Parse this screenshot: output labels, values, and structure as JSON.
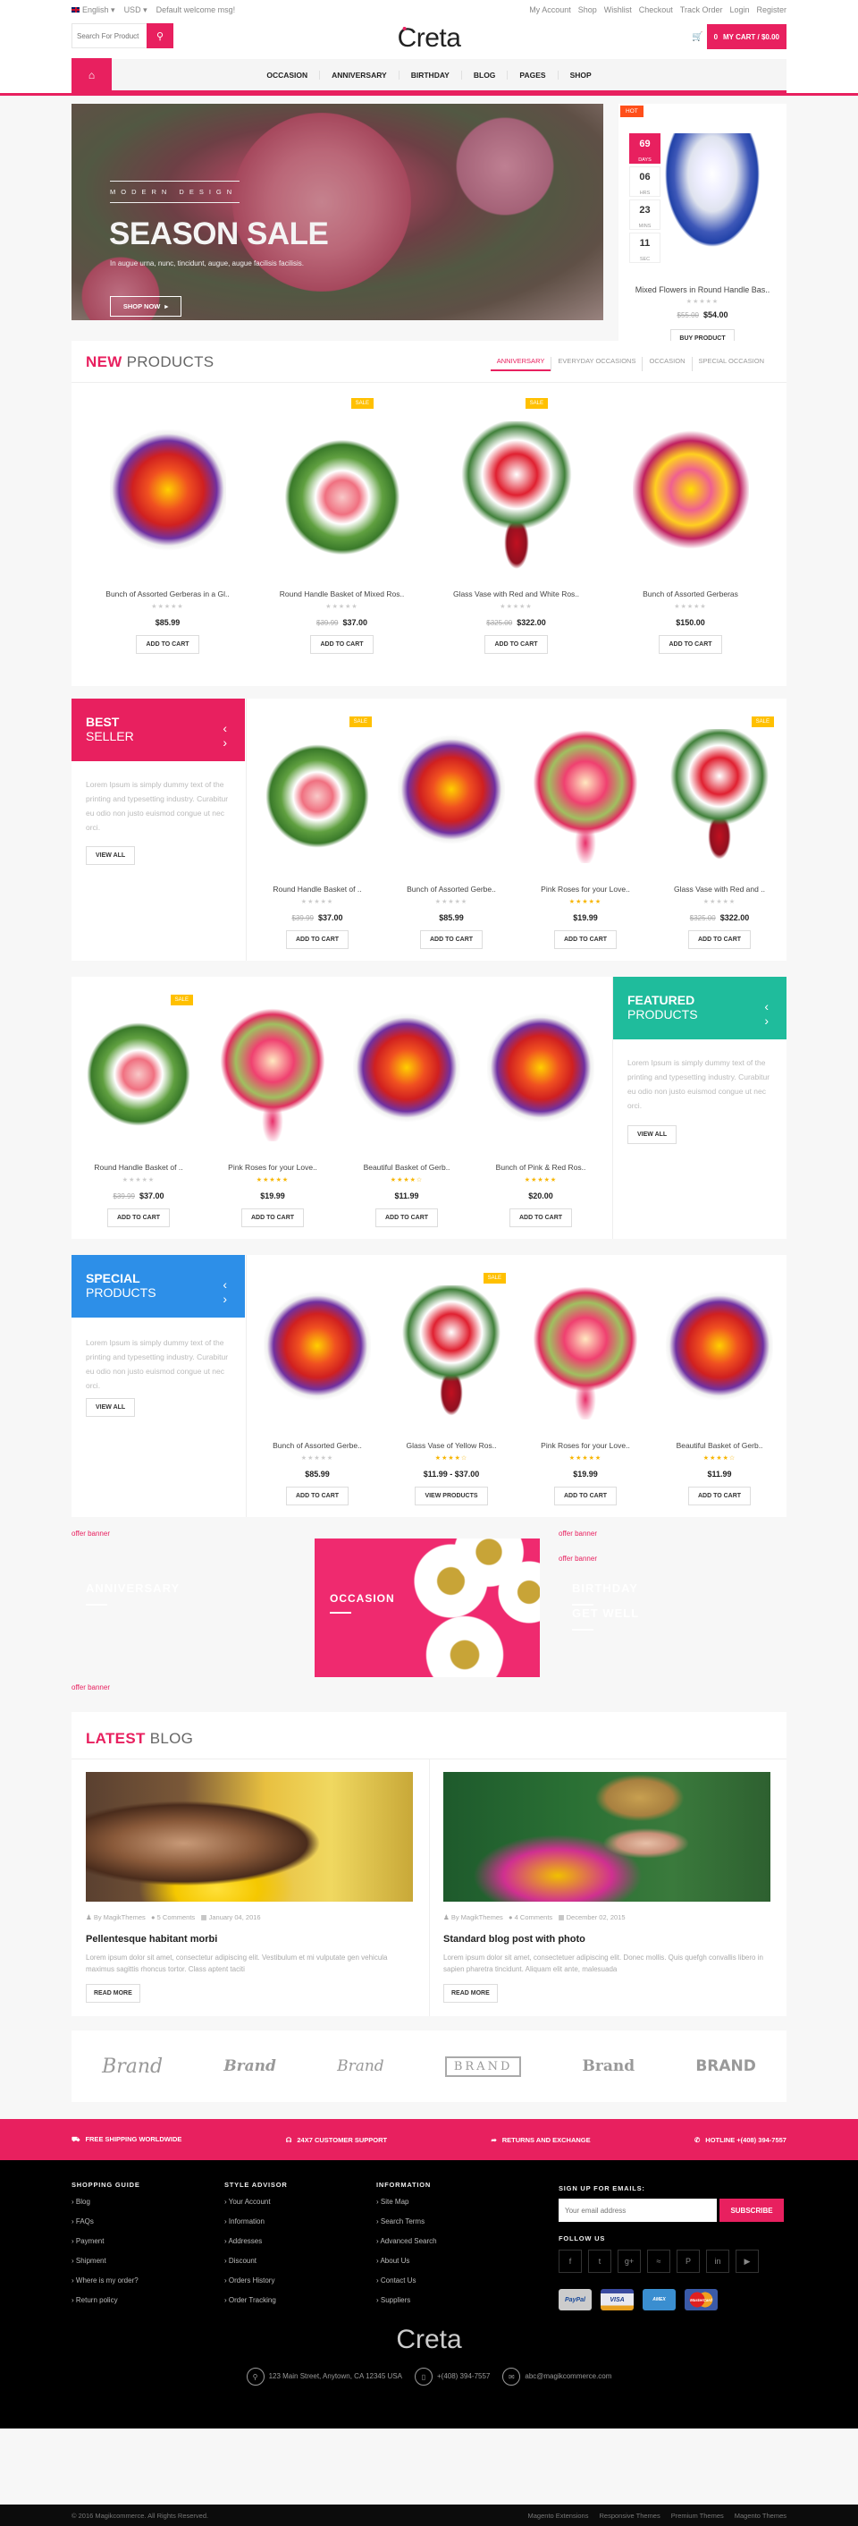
{
  "topbar": {
    "language": "English",
    "currency": "USD",
    "welcome": "Default welcome msg!",
    "links": [
      "My Account",
      "Shop",
      "Wishlist",
      "Checkout",
      "Track Order",
      "Login",
      "Register"
    ]
  },
  "header": {
    "search_placeholder": "Search For Product",
    "logo": "Creta",
    "cart_label": "MY CART / $0.00",
    "cart_count": "0"
  },
  "nav": {
    "items": [
      "OCCASION",
      "ANNIVERSARY",
      "BIRTHDAY",
      "BLOG",
      "PAGES",
      "SHOP"
    ]
  },
  "hero": {
    "kicker": "MODERN DESIGN",
    "title": "SEASON SALE",
    "subtitle": "In augue urna, nunc, tincidunt, augue, augue facilisis facilisis.",
    "cta": "SHOP NOW"
  },
  "deal": {
    "badge": "HOT",
    "countdown": [
      {
        "value": "69",
        "unit": "DAYS"
      },
      {
        "value": "06",
        "unit": "HRS"
      },
      {
        "value": "23",
        "unit": "MINS"
      },
      {
        "value": "11",
        "unit": "SEC"
      }
    ],
    "name": "Mixed Flowers in Round Handle Bas..",
    "old_price": "$55.00",
    "price": "$54.00",
    "button": "BUY PRODUCT"
  },
  "new_products": {
    "title_bold": "NEW",
    "title_light": "PRODUCTS",
    "tabs": [
      "ANNIVERSARY",
      "EVERYDAY OCCASIONS",
      "OCCASION",
      "SPECIAL OCCASION"
    ],
    "items": [
      {
        "name": "Bunch of Assorted Gerberas in a Gl..",
        "old": "",
        "price": "$85.99",
        "sale": "",
        "rating": 0,
        "button": "ADD TO CART"
      },
      {
        "name": "Round Handle Basket of Mixed Ros..",
        "old": "$39.99",
        "price": "$37.00",
        "sale": "SALE",
        "rating": 0,
        "button": "ADD TO CART"
      },
      {
        "name": "Glass Vase with Red and White Ros..",
        "old": "$325.00",
        "price": "$322.00",
        "sale": "SALE",
        "rating": 0,
        "button": "ADD TO CART"
      },
      {
        "name": "Bunch of Assorted Gerberas",
        "old": "",
        "price": "$150.00",
        "sale": "",
        "rating": 0,
        "button": "ADD TO CART"
      }
    ]
  },
  "best_seller": {
    "title_bold": "BEST",
    "title_light": "SELLER",
    "text": "Lorem Ipsum is simply dummy text of the printing and typesetting industry. Curabitur eu odio non justo euismod congue ut nec orci.",
    "view_all": "VIEW ALL",
    "color": "#e8205f",
    "items": [
      {
        "name": "Round Handle Basket of ..",
        "old": "$39.99",
        "price": "$37.00",
        "sale": "SALE",
        "rating": 0,
        "button": "ADD TO CART"
      },
      {
        "name": "Bunch of Assorted Gerbe..",
        "old": "",
        "price": "$85.99",
        "sale": "",
        "rating": 0,
        "button": "ADD TO CART"
      },
      {
        "name": "Pink Roses for your Love..",
        "old": "",
        "price": "$19.99",
        "sale": "",
        "rating": 5,
        "button": "ADD TO CART"
      },
      {
        "name": "Glass Vase with Red and ..",
        "old": "$325.00",
        "price": "$322.00",
        "sale": "SALE",
        "rating": 0,
        "button": "ADD TO CART"
      }
    ]
  },
  "featured": {
    "title_bold": "FEATURED",
    "title_light": "PRODUCTS",
    "text": "Lorem Ipsum is simply dummy text of the printing and typesetting industry. Curabitur eu odio non justo euismod congue ut nec orci.",
    "view_all": "VIEW ALL",
    "color": "#1fbc9c",
    "items": [
      {
        "name": "Round Handle Basket of ..",
        "old": "$39.99",
        "price": "$37.00",
        "sale": "SALE",
        "rating": 0,
        "button": "ADD TO CART"
      },
      {
        "name": "Pink Roses for your Love..",
        "old": "",
        "price": "$19.99",
        "sale": "",
        "rating": 5,
        "button": "ADD TO CART"
      },
      {
        "name": "Beautiful Basket of Gerb..",
        "old": "",
        "price": "$11.99",
        "sale": "",
        "rating": 4,
        "button": "ADD TO CART"
      },
      {
        "name": "Bunch of Pink & Red Ros..",
        "old": "",
        "price": "$20.00",
        "sale": "",
        "rating": 5,
        "button": "ADD TO CART"
      }
    ]
  },
  "special": {
    "title_bold": "SPECIAL",
    "title_light": "PRODUCTS",
    "text": "Lorem Ipsum is simply dummy text of the printing and typesetting industry. Curabitur eu odio non justo euismod congue ut nec orci.",
    "view_all": "VIEW ALL",
    "color": "#2d8fe8",
    "items": [
      {
        "name": "Bunch of Assorted Gerbe..",
        "old": "",
        "price": "$85.99",
        "sale": "",
        "rating": 0,
        "button": "ADD TO CART"
      },
      {
        "name": "Glass Vase of Yellow Ros..",
        "old": "",
        "price": "$11.99 - $37.00",
        "sale": "SALE",
        "rating": 4.5,
        "button": "VIEW PRODUCTS"
      },
      {
        "name": "Pink Roses for your Love..",
        "old": "",
        "price": "$19.99",
        "sale": "",
        "rating": 5,
        "button": "ADD TO CART"
      },
      {
        "name": "Beautiful Basket of Gerb..",
        "old": "",
        "price": "$11.99",
        "sale": "",
        "rating": 4,
        "button": "ADD TO CART"
      }
    ]
  },
  "banners": {
    "offer_label": "offer banner",
    "anniversary": "ANNIVERSARY",
    "occasion": "OCCASION",
    "birthday": "BIRTHDAY",
    "get_well": "GET WELL"
  },
  "blog": {
    "title_bold": "LATEST",
    "title_light": "BLOG",
    "posts": [
      {
        "author": "By MagikThemes",
        "comments": "5 Comments",
        "date": "January 04, 2016",
        "title": "Pellentesque habitant morbi",
        "excerpt": "Lorem ipsum dolor sit amet, consectetur adipiscing elit. Vestibulum et mi vulputate gen vehicula maximus sagittis rhoncus tortor. Class aptent taciti",
        "button": "READ MORE"
      },
      {
        "author": "By MagikThemes",
        "comments": "4 Comments",
        "date": "December 02, 2015",
        "title": "Standard blog post with photo",
        "excerpt": "Lorem ipsum dolor sit amet, consectetuer adipiscing elit. Donec mollis. Quis quefgh convallis libero in sapien pharetra tincidunt. Aliquam elit ante, malesuada",
        "button": "READ MORE"
      }
    ]
  },
  "brands": [
    "Brand",
    "Brand",
    "Brand",
    "BRAND",
    "Brand",
    "BRAND"
  ],
  "features": [
    {
      "icon": "truck-icon",
      "label": "FREE SHIPPING WORLDWIDE"
    },
    {
      "icon": "headset-icon",
      "label": "24X7 CUSTOMER SUPPORT"
    },
    {
      "icon": "share-icon",
      "label": "RETURNS AND EXCHANGE"
    },
    {
      "icon": "phone-icon",
      "label": "HOTLINE +(408) 394-7557"
    }
  ],
  "footer": {
    "columns": [
      {
        "title": "SHOPPING GUIDE",
        "links": [
          "Blog",
          "FAQs",
          "Payment",
          "Shipment",
          "Where is my order?",
          "Return policy"
        ]
      },
      {
        "title": "STYLE ADVISOR",
        "links": [
          "Your Account",
          "Information",
          "Addresses",
          "Discount",
          "Orders History",
          "Order Tracking"
        ]
      },
      {
        "title": "INFORMATION",
        "links": [
          "Site Map",
          "Search Terms",
          "Advanced Search",
          "About Us",
          "Contact Us",
          "Suppliers"
        ]
      }
    ],
    "signup_title": "SIGN UP FOR EMAILS:",
    "email_placeholder": "Your email address",
    "subscribe": "SUBSCRIBE",
    "follow_title": "FOLLOW US",
    "social": [
      "f",
      "t",
      "g+",
      "rss",
      "p",
      "in",
      "yt"
    ],
    "cards": [
      "PayPal",
      "VISA",
      "AMEX",
      "MasterCard"
    ],
    "logo": "Creta",
    "address": "123 Main Street, Anytown, CA 12345 USA",
    "phone": "+(408) 394-7557",
    "email": "abc@magikcommerce.com",
    "copyright": "© 2016 Magikcommerce. All Rights Reserved.",
    "bottom_links": [
      "Magento Extensions",
      "Responsive Themes",
      "Premium Themes",
      "Magento Themes"
    ]
  }
}
